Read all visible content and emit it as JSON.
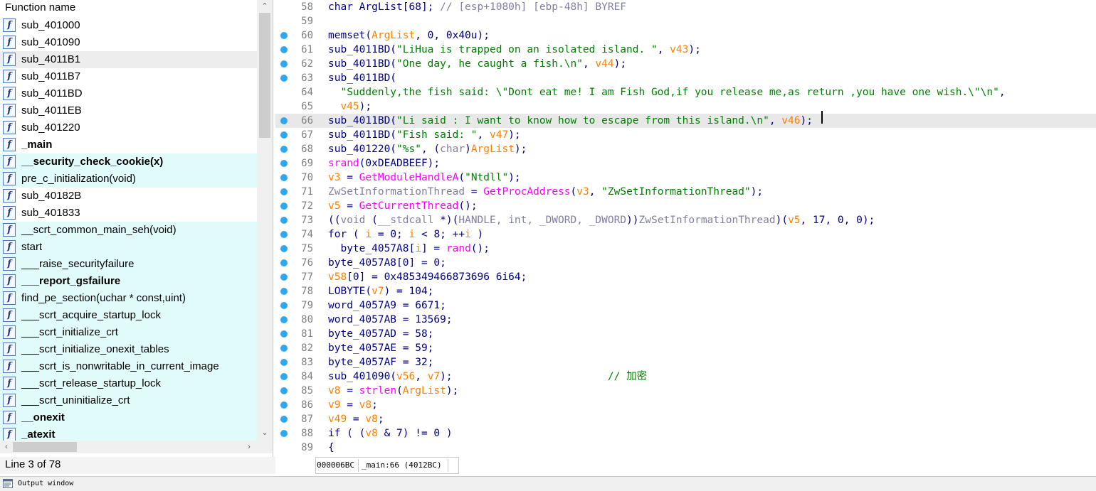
{
  "functions_panel": {
    "header": "Function name",
    "status": "Line 3 of 78",
    "items": [
      {
        "name": "sub_401000",
        "style": "normal"
      },
      {
        "name": "sub_401090",
        "style": "normal"
      },
      {
        "name": "sub_4011B1",
        "style": "selected"
      },
      {
        "name": "sub_4011B7",
        "style": "normal"
      },
      {
        "name": "sub_4011BD",
        "style": "normal"
      },
      {
        "name": "sub_4011EB",
        "style": "normal"
      },
      {
        "name": "sub_401220",
        "style": "normal"
      },
      {
        "name": "_main",
        "style": "bold"
      },
      {
        "name": "__security_check_cookie(x)",
        "style": "bold-hl"
      },
      {
        "name": "pre_c_initialization(void)",
        "style": "hl"
      },
      {
        "name": "sub_40182B",
        "style": "normal"
      },
      {
        "name": "sub_401833",
        "style": "normal"
      },
      {
        "name": "__scrt_common_main_seh(void)",
        "style": "hl"
      },
      {
        "name": "start",
        "style": "hl"
      },
      {
        "name": "___raise_securityfailure",
        "style": "hl"
      },
      {
        "name": "___report_gsfailure",
        "style": "bold-hl"
      },
      {
        "name": "find_pe_section(uchar * const,uint)",
        "style": "hl"
      },
      {
        "name": "___scrt_acquire_startup_lock",
        "style": "hl"
      },
      {
        "name": "___scrt_initialize_crt",
        "style": "hl"
      },
      {
        "name": "___scrt_initialize_onexit_tables",
        "style": "hl"
      },
      {
        "name": "___scrt_is_nonwritable_in_current_image",
        "style": "hl"
      },
      {
        "name": "___scrt_release_startup_lock",
        "style": "hl"
      },
      {
        "name": "___scrt_uninitialize_crt",
        "style": "hl"
      },
      {
        "name": "__onexit",
        "style": "bold-hl"
      },
      {
        "name": "_atexit",
        "style": "bold-hl"
      }
    ]
  },
  "code": {
    "current_line": 66,
    "lines": [
      {
        "num": "58",
        "dot": false,
        "parts": [
          [
            "t",
            "char ArgList[68]; "
          ],
          [
            "g",
            "// [esp+1080h] [ebp-48h] BYREF"
          ]
        ]
      },
      {
        "num": "59",
        "dot": false,
        "parts": []
      },
      {
        "num": "60",
        "dot": true,
        "parts": [
          [
            "t",
            "memset("
          ],
          [
            "v",
            "ArgList"
          ],
          [
            "t",
            ", 0, 0x40u);"
          ]
        ]
      },
      {
        "num": "61",
        "dot": true,
        "parts": [
          [
            "t",
            "sub_4011BD("
          ],
          [
            "s",
            "\"LiHua is trapped on an isolated island. \""
          ],
          [
            "t",
            ", "
          ],
          [
            "v",
            "v43"
          ],
          [
            "t",
            ");"
          ]
        ]
      },
      {
        "num": "62",
        "dot": true,
        "parts": [
          [
            "t",
            "sub_4011BD("
          ],
          [
            "s",
            "\"One day, he caught a fish.\\n\""
          ],
          [
            "t",
            ", "
          ],
          [
            "v",
            "v44"
          ],
          [
            "t",
            ");"
          ]
        ]
      },
      {
        "num": "63",
        "dot": true,
        "parts": [
          [
            "t",
            "sub_4011BD("
          ]
        ]
      },
      {
        "num": "64",
        "dot": false,
        "parts": [
          [
            "t",
            "  "
          ],
          [
            "s",
            "\"Suddenly,the fish said: \\\"Dont eat me! I am Fish God,if you release me,as return ,you have one wish.\\\"\\n\""
          ],
          [
            "t",
            ","
          ]
        ]
      },
      {
        "num": "65",
        "dot": false,
        "parts": [
          [
            "t",
            "  "
          ],
          [
            "v",
            "v45"
          ],
          [
            "t",
            ");"
          ]
        ]
      },
      {
        "num": "66",
        "dot": true,
        "parts": [
          [
            "t",
            "sub_4011BD("
          ],
          [
            "s",
            "\"Li said : I want to know how to escape from this island.\\n\""
          ],
          [
            "t",
            ", "
          ],
          [
            "v",
            "v46"
          ],
          [
            "t",
            ");"
          ]
        ]
      },
      {
        "num": "67",
        "dot": true,
        "parts": [
          [
            "t",
            "sub_4011BD("
          ],
          [
            "s",
            "\"Fish said: \""
          ],
          [
            "t",
            ", "
          ],
          [
            "v",
            "v47"
          ],
          [
            "t",
            ");"
          ]
        ]
      },
      {
        "num": "68",
        "dot": true,
        "parts": [
          [
            "t",
            "sub_401220("
          ],
          [
            "s",
            "\"%s\""
          ],
          [
            "t",
            ", ("
          ],
          [
            "g",
            "char"
          ],
          [
            "t",
            ")"
          ],
          [
            "v",
            "ArgList"
          ],
          [
            "t",
            ");"
          ]
        ]
      },
      {
        "num": "69",
        "dot": true,
        "parts": [
          [
            "m",
            "srand"
          ],
          [
            "t",
            "(0xDEADBEEF);"
          ]
        ]
      },
      {
        "num": "70",
        "dot": true,
        "parts": [
          [
            "v",
            "v3"
          ],
          [
            "t",
            " = "
          ],
          [
            "m",
            "GetModuleHandleA"
          ],
          [
            "t",
            "("
          ],
          [
            "s",
            "\"Ntdll\""
          ],
          [
            "t",
            ");"
          ]
        ]
      },
      {
        "num": "71",
        "dot": true,
        "parts": [
          [
            "g",
            "ZwSetInformationThread"
          ],
          [
            "t",
            " = "
          ],
          [
            "m",
            "GetProcAddress"
          ],
          [
            "t",
            "("
          ],
          [
            "v",
            "v3"
          ],
          [
            "t",
            ", "
          ],
          [
            "s",
            "\"ZwSetInformationThread\""
          ],
          [
            "t",
            ");"
          ]
        ]
      },
      {
        "num": "72",
        "dot": true,
        "parts": [
          [
            "v",
            "v5"
          ],
          [
            "t",
            " = "
          ],
          [
            "m",
            "GetCurrentThread"
          ],
          [
            "t",
            "();"
          ]
        ]
      },
      {
        "num": "73",
        "dot": true,
        "parts": [
          [
            "t",
            "(("
          ],
          [
            "g",
            "void"
          ],
          [
            "t",
            " ("
          ],
          [
            "g",
            "__stdcall"
          ],
          [
            "t",
            " *)("
          ],
          [
            "g",
            "HANDLE, int, _DWORD, _DWORD"
          ],
          [
            "t",
            "))"
          ],
          [
            "g",
            "ZwSetInformationThread"
          ],
          [
            "t",
            ")("
          ],
          [
            "v",
            "v5"
          ],
          [
            "t",
            ", 17, 0, 0);"
          ]
        ]
      },
      {
        "num": "74",
        "dot": true,
        "parts": [
          [
            "t",
            "for ( "
          ],
          [
            "v",
            "i"
          ],
          [
            "t",
            " = 0; "
          ],
          [
            "v",
            "i"
          ],
          [
            "t",
            " < 8; ++"
          ],
          [
            "v",
            "i"
          ],
          [
            "t",
            " )"
          ]
        ]
      },
      {
        "num": "75",
        "dot": true,
        "parts": [
          [
            "t",
            "  byte_4057A8["
          ],
          [
            "v",
            "i"
          ],
          [
            "t",
            "] = "
          ],
          [
            "m",
            "rand"
          ],
          [
            "t",
            "();"
          ]
        ]
      },
      {
        "num": "76",
        "dot": true,
        "parts": [
          [
            "t",
            "byte_4057A8[0] = 0;"
          ]
        ]
      },
      {
        "num": "77",
        "dot": true,
        "parts": [
          [
            "v",
            "v58"
          ],
          [
            "t",
            "[0] = 0x485349466873696 6i64;"
          ]
        ]
      },
      {
        "num": "78",
        "dot": true,
        "parts": [
          [
            "t",
            "LOBYTE("
          ],
          [
            "v",
            "v7"
          ],
          [
            "t",
            ") = 104;"
          ]
        ]
      },
      {
        "num": "79",
        "dot": true,
        "parts": [
          [
            "t",
            "word_4057A9 = 6671;"
          ]
        ]
      },
      {
        "num": "80",
        "dot": true,
        "parts": [
          [
            "t",
            "word_4057AB = 13569;"
          ]
        ]
      },
      {
        "num": "81",
        "dot": true,
        "parts": [
          [
            "t",
            "byte_4057AD = 58;"
          ]
        ]
      },
      {
        "num": "82",
        "dot": true,
        "parts": [
          [
            "t",
            "byte_4057AE = 59;"
          ]
        ]
      },
      {
        "num": "83",
        "dot": true,
        "parts": [
          [
            "t",
            "byte_4057AF = 32;"
          ]
        ]
      },
      {
        "num": "84",
        "dot": true,
        "parts": [
          [
            "t",
            "sub_401090("
          ],
          [
            "v",
            "v56"
          ],
          [
            "t",
            ", "
          ],
          [
            "v",
            "v7"
          ],
          [
            "t",
            ");                         "
          ],
          [
            "c",
            "// 加密"
          ]
        ]
      },
      {
        "num": "85",
        "dot": true,
        "parts": [
          [
            "v",
            "v8"
          ],
          [
            "t",
            " = "
          ],
          [
            "m",
            "strlen"
          ],
          [
            "t",
            "("
          ],
          [
            "v",
            "ArgList"
          ],
          [
            "t",
            ");"
          ]
        ]
      },
      {
        "num": "86",
        "dot": true,
        "parts": [
          [
            "v",
            "v9"
          ],
          [
            "t",
            " = "
          ],
          [
            "v",
            "v8"
          ],
          [
            "t",
            ";"
          ]
        ]
      },
      {
        "num": "87",
        "dot": true,
        "parts": [
          [
            "v",
            "v49"
          ],
          [
            "t",
            " = "
          ],
          [
            "v",
            "v8"
          ],
          [
            "t",
            ";"
          ]
        ]
      },
      {
        "num": "88",
        "dot": true,
        "parts": [
          [
            "t",
            "if ( ("
          ],
          [
            "v",
            "v8"
          ],
          [
            "t",
            " & 7) != 0 )"
          ]
        ]
      },
      {
        "num": "89",
        "dot": false,
        "parts": [
          [
            "t",
            "{"
          ]
        ]
      }
    ]
  },
  "code_status": {
    "address": "000006BC",
    "location": "_main:66 (4012BC)"
  },
  "output_window": {
    "label": "Output window"
  },
  "colors": {
    "highlight_row": "#e1fafa",
    "breakpoint_dot": "#30a8f0",
    "variable": "#ff8000",
    "string": "#008000",
    "api": "#ff00ff",
    "text": "#000080"
  }
}
